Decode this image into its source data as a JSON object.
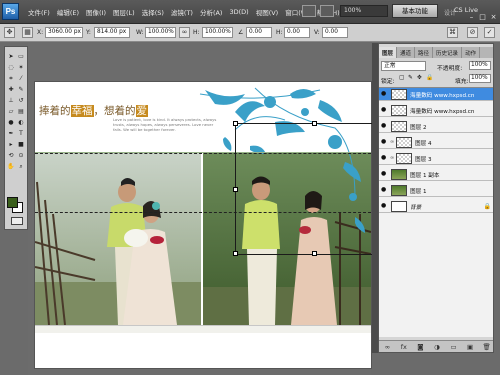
{
  "menubar": {
    "items": [
      "文件(F)",
      "编辑(E)",
      "图像(I)",
      "图层(L)",
      "选择(S)",
      "滤镜(T)",
      "分析(A)",
      "3D(D)",
      "视图(V)",
      "窗口(W)",
      "帮助(H)"
    ],
    "zoom": "100%",
    "workspace": "基本功能",
    "workspace_links": [
      "设计",
      "绘画",
      "»"
    ],
    "cs_live": "CS Live",
    "window_controls": [
      "–",
      "□",
      "×"
    ]
  },
  "options": {
    "x_label": "X:",
    "x_value": "3060.00 px",
    "y_label": "Y:",
    "y_value": "814.00 px",
    "w_label": "W:",
    "w_value": "100.00%",
    "h_label": "H:",
    "h_value": "100.00%",
    "angle_value": "0.00",
    "hskew_label": "H:",
    "hskew_value": "0.00",
    "vskew_label": "V:",
    "vskew_value": "0.00"
  },
  "document": {
    "title_a": "捧着的",
    "title_b": "幸福",
    "title_c": "，想着的",
    "title_d": "爱",
    "subtitle": "Love is patient, love is kind. It always protects, always trusts, always hopes, always perseveres. Love never fails. We will be together forever."
  },
  "layers": {
    "tabs": [
      "图层",
      "通道",
      "路径",
      "历史记录",
      "动作"
    ],
    "blend_mode": "正常",
    "opacity_label": "不透明度:",
    "opacity_value": "100%",
    "lock_label": "锁定:",
    "fill_label": "填充:",
    "fill_value": "100%",
    "items": [
      {
        "name": "海量数码 www.hxpsd.cn",
        "selected": true
      },
      {
        "name": "海量数码 www.hxpsd.cn",
        "selected": false
      },
      {
        "name": "图层 2",
        "selected": false
      },
      {
        "name": "图层 4",
        "selected": false
      },
      {
        "name": "图层 3",
        "selected": false
      },
      {
        "name": "图层 1 副本",
        "selected": false
      },
      {
        "name": "图层 1",
        "selected": false
      },
      {
        "name": "背景",
        "selected": false
      }
    ],
    "bottom_buttons": [
      "link-icon",
      "fx-icon",
      "mask-icon",
      "adjustment-icon",
      "folder-icon",
      "new-layer-icon",
      "trash-icon"
    ]
  },
  "colors": {
    "foreground": "#3a5f1c",
    "background": "#ffffff",
    "selected_layer": "#3f8be0",
    "title_highlight": "#c68a1e"
  }
}
